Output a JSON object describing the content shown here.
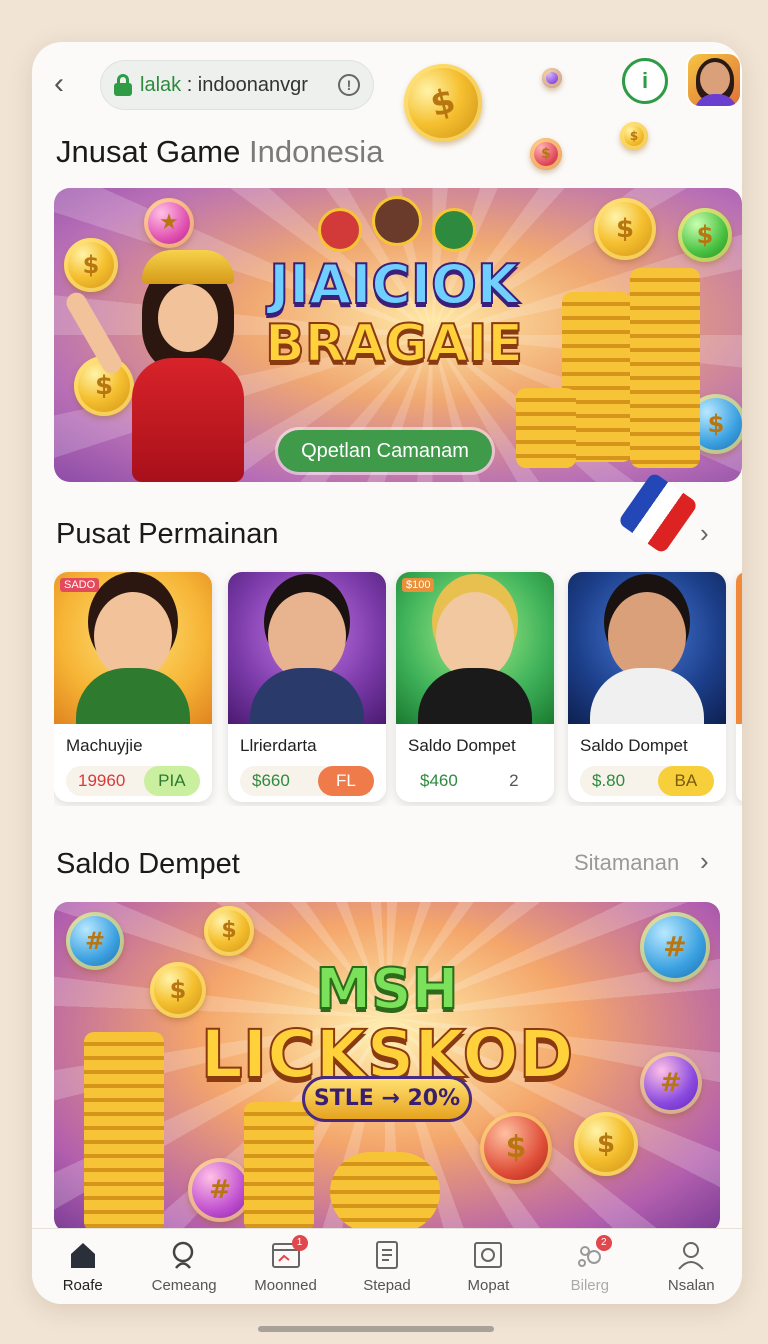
{
  "browser": {
    "url_prefix": "lalak",
    "url_rest": " : indoonanvgr",
    "info_glyph": "!",
    "alert_glyph": "i"
  },
  "page_title": {
    "strong": "Jnusat Game",
    "light": " Indonesia"
  },
  "hero": {
    "logo_line1": "JIAICIOK",
    "logo_line2": "BRAGAIE",
    "cta": "Qpetlan Camanam"
  },
  "section_games": {
    "title": "Pusat Permainan"
  },
  "games": [
    {
      "name": "Machuyjie",
      "amount": "19960",
      "tag": "PIA",
      "badge": "SADO",
      "amount_color": "#d83a3a",
      "tag_bg": "#c9ef9f",
      "tag_color": "#2f7a2f",
      "bg": "#f6b435"
    },
    {
      "name": "Llrierdarta",
      "amount": "$660",
      "tag": "FL",
      "badge": "",
      "amount_color": "#2e8a3e",
      "tag_bg": "#ef7a4a",
      "tag_color": "#ffffff",
      "bg": "#7a3aa8"
    },
    {
      "name": "Saldo Dompet",
      "amount": "$460",
      "tag": "2",
      "badge": "$100",
      "amount_color": "#2e8a3e",
      "tag_bg": "transparent",
      "tag_color": "#555555",
      "bg": "#3fb25a"
    },
    {
      "name": "Saldo Dompet",
      "amount": "$.80",
      "tag": "BA",
      "badge": "",
      "amount_color": "#2e8a3e",
      "tag_bg": "#f6cf3a",
      "tag_color": "#7a5a10",
      "bg": "#1c3f8a"
    }
  ],
  "section_wallet": {
    "title": "Saldo Dempet",
    "link": "Sitamanan"
  },
  "promo": {
    "logo_line1": "MSH",
    "logo_line2": "LICKSKOD",
    "pill": "STLE → 20%"
  },
  "nav": [
    {
      "label": "Roafe",
      "icon": "home-icon",
      "active": true,
      "badge": ""
    },
    {
      "label": "Cemeang",
      "icon": "search-icon",
      "active": false,
      "badge": ""
    },
    {
      "label": "Moonned",
      "icon": "calendar-icon",
      "active": false,
      "badge": "1"
    },
    {
      "label": "Stepad",
      "icon": "document-icon",
      "active": false,
      "badge": ""
    },
    {
      "label": "Mopat",
      "icon": "square-icon",
      "active": false,
      "badge": ""
    },
    {
      "label": "Bilerg",
      "icon": "bell-icon",
      "active": false,
      "badge": "2"
    },
    {
      "label": "Nsalan",
      "icon": "user-icon",
      "active": false,
      "badge": ""
    }
  ],
  "colors": {
    "accent_green": "#3f9a4a",
    "background": "#f1e4d4"
  }
}
